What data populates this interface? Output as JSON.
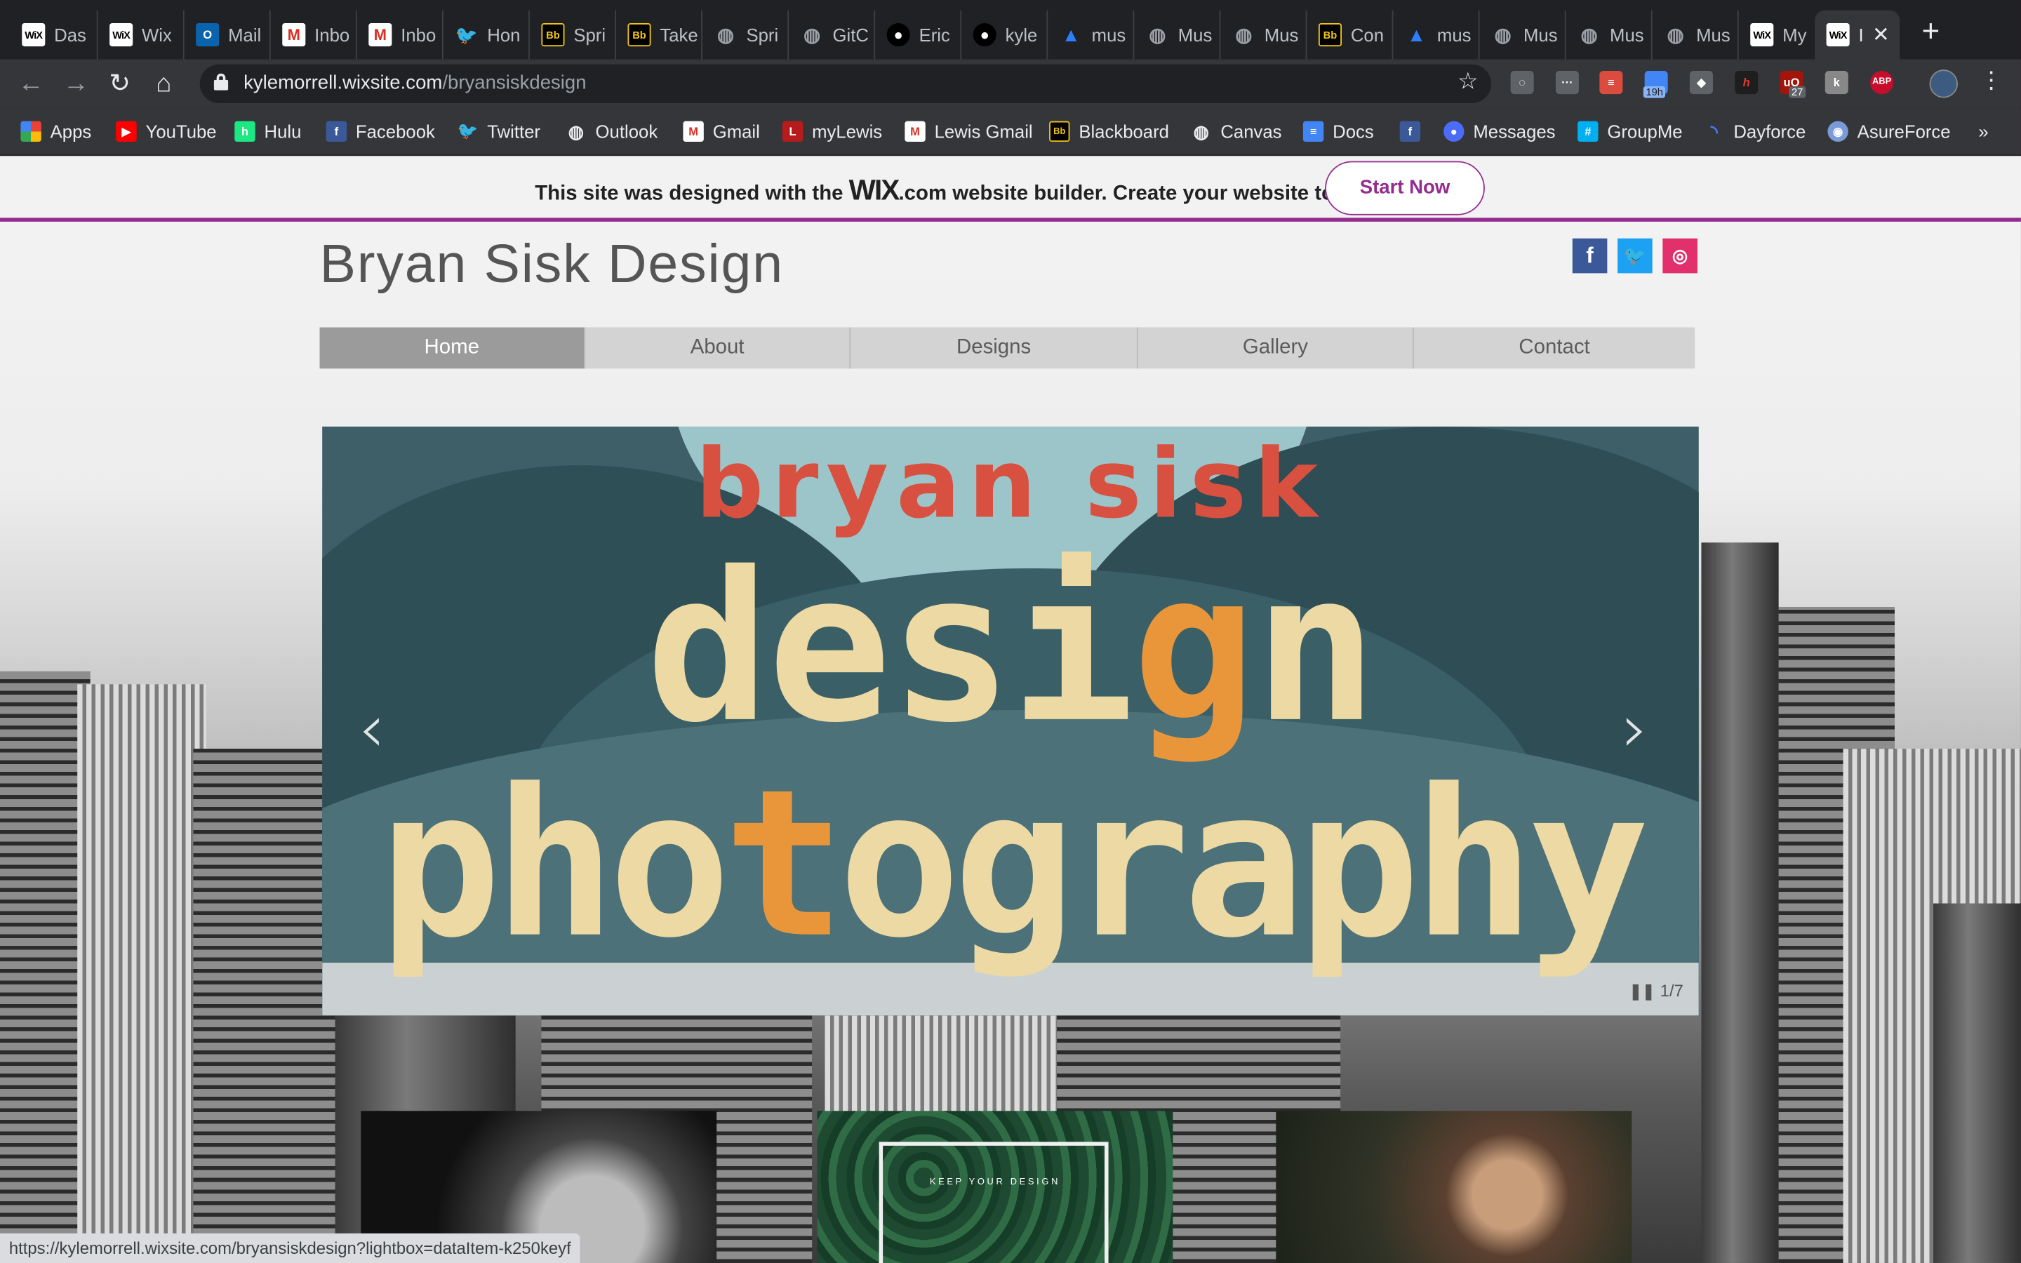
{
  "tabs": [
    {
      "label": "Das",
      "favicon": "wix-icon"
    },
    {
      "label": "Wix",
      "favicon": "wix-icon"
    },
    {
      "label": "Mail",
      "favicon": "outlook-icon"
    },
    {
      "label": "Inbo",
      "favicon": "gmail-icon"
    },
    {
      "label": "Inbo",
      "favicon": "gmail-icon"
    },
    {
      "label": "Hon",
      "favicon": "twitter-icon"
    },
    {
      "label": "Spri",
      "favicon": "blackboard-icon"
    },
    {
      "label": "Take",
      "favicon": "blackboard-icon"
    },
    {
      "label": "Spri",
      "favicon": "globe-icon"
    },
    {
      "label": "GitC",
      "favicon": "globe-icon"
    },
    {
      "label": "Eric",
      "favicon": "github-icon"
    },
    {
      "label": "kyle",
      "favicon": "github-icon"
    },
    {
      "label": "mus",
      "favicon": "triangle-icon"
    },
    {
      "label": "Mus",
      "favicon": "globe-icon"
    },
    {
      "label": "Mus",
      "favicon": "globe-icon"
    },
    {
      "label": "Con",
      "favicon": "blackboard-icon"
    },
    {
      "label": "mus",
      "favicon": "triangle-icon"
    },
    {
      "label": "Mus",
      "favicon": "globe-icon"
    },
    {
      "label": "Mus",
      "favicon": "globe-icon"
    },
    {
      "label": "Mus",
      "favicon": "globe-icon"
    },
    {
      "label": "My",
      "favicon": "wix-icon"
    },
    {
      "label": "I",
      "favicon": "wix-icon",
      "active": true
    }
  ],
  "browser": {
    "url_host": "kylemorrell.wixsite.com",
    "url_path": "/bryansiskdesign",
    "ext_badges": {
      "calendar": "19h",
      "ublock": "27",
      "abp": "ABP"
    }
  },
  "bookmarks": [
    "Apps",
    "YouTube",
    "Hulu",
    "Facebook",
    "Twitter",
    "Outlook",
    "Gmail",
    "myLewis",
    "Lewis Gmail",
    "Blackboard",
    "Canvas",
    "Docs",
    "",
    "Messages",
    "GroupMe",
    "Dayforce",
    "AsureForce"
  ],
  "wix_banner": {
    "prefix": "This site was designed with the ",
    "brand": "WIX",
    "domain": ".com",
    "suffix": " website builder. Create your website today.",
    "button": "Start Now"
  },
  "site": {
    "title": "Bryan Sisk Design",
    "nav": [
      "Home",
      "About",
      "Designs",
      "Gallery",
      "Contact"
    ],
    "active_nav": "Home"
  },
  "slideshow": {
    "line1": "bryan sisk",
    "line2_a": "desi",
    "line2_b": "g",
    "line2_c": "n",
    "line3_a": "pho",
    "line3_b": "t",
    "line3_c": "ography",
    "counter": "1/7",
    "prev": "‹",
    "next": "›"
  },
  "thumbnails": {
    "caption2": "KEEP YOUR DESIGN"
  },
  "status_url": "https://kylemorrell.wixsite.com/bryansiskdesign?lightbox=dataItem-k250keyf",
  "colors": {
    "wix_purple": "#942b8f",
    "nav_active": "#9b9b9b",
    "brand_red": "#d85040",
    "brand_orange": "#e9963a",
    "brand_cream": "#ecd9a3"
  }
}
